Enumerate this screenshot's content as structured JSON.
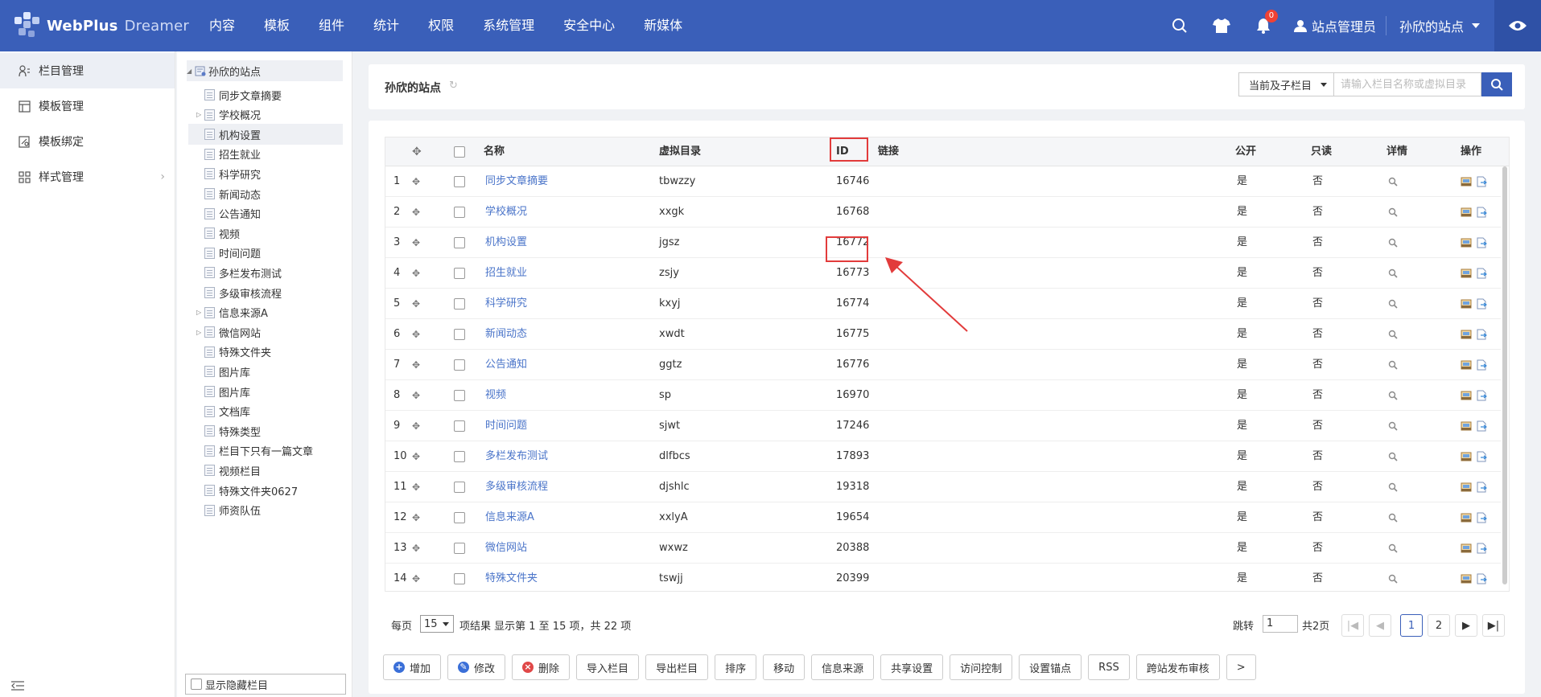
{
  "header": {
    "brand": "WebPlus",
    "brand_sub": "Dreamer",
    "nav": [
      "内容",
      "模板",
      "组件",
      "统计",
      "权限",
      "系统管理",
      "安全中心",
      "新媒体"
    ],
    "notif_count": "0",
    "user": "站点管理员",
    "site": "孙欣的站点"
  },
  "left_menu": {
    "items": [
      {
        "label": "栏目管理",
        "icon": "columns-icon"
      },
      {
        "label": "模板管理",
        "icon": "template-icon"
      },
      {
        "label": "模板绑定",
        "icon": "bind-icon"
      },
      {
        "label": "样式管理",
        "icon": "style-icon"
      }
    ]
  },
  "tree": {
    "root": "孙欣的站点",
    "nodes": [
      {
        "label": "同步文章摘要",
        "expandable": false
      },
      {
        "label": "学校概况",
        "expandable": true
      },
      {
        "label": "机构设置",
        "expandable": false,
        "selected": true
      },
      {
        "label": "招生就业",
        "expandable": false
      },
      {
        "label": "科学研究",
        "expandable": false
      },
      {
        "label": "新闻动态",
        "expandable": false
      },
      {
        "label": "公告通知",
        "expandable": false
      },
      {
        "label": "视频",
        "expandable": false
      },
      {
        "label": "时间问题",
        "expandable": false
      },
      {
        "label": "多栏发布测试",
        "expandable": false
      },
      {
        "label": "多级审核流程",
        "expandable": false
      },
      {
        "label": "信息来源A",
        "expandable": true
      },
      {
        "label": "微信网站",
        "expandable": true
      },
      {
        "label": "特殊文件夹",
        "expandable": false
      },
      {
        "label": "图片库",
        "expandable": false
      },
      {
        "label": "图片库",
        "expandable": false
      },
      {
        "label": "文档库",
        "expandable": false
      },
      {
        "label": "特殊类型",
        "expandable": false
      },
      {
        "label": "栏目下只有一篇文章",
        "expandable": false
      },
      {
        "label": "视频栏目",
        "expandable": false
      },
      {
        "label": "特殊文件夹0627",
        "expandable": false
      },
      {
        "label": "师资队伍",
        "expandable": false
      }
    ],
    "show_hidden_label": "显示隐藏栏目"
  },
  "content": {
    "site_title": "孙欣的站点",
    "scope_select": "当前及子栏目",
    "search_placeholder": "请输入栏目名称或虚拟目录"
  },
  "table": {
    "headers": {
      "name": "名称",
      "vdir": "虚拟目录",
      "id": "ID",
      "link": "链接",
      "public": "公开",
      "readonly": "只读",
      "detail": "详情",
      "ops": "操作"
    },
    "rows": [
      {
        "no": "1",
        "name": "同步文章摘要",
        "vdir": "tbwzzy",
        "id": "16746",
        "public": "是",
        "readonly": "否"
      },
      {
        "no": "2",
        "name": "学校概况",
        "vdir": "xxgk",
        "id": "16768",
        "public": "是",
        "readonly": "否"
      },
      {
        "no": "3",
        "name": "机构设置",
        "vdir": "jgsz",
        "id": "16772",
        "public": "是",
        "readonly": "否"
      },
      {
        "no": "4",
        "name": "招生就业",
        "vdir": "zsjy",
        "id": "16773",
        "public": "是",
        "readonly": "否"
      },
      {
        "no": "5",
        "name": "科学研究",
        "vdir": "kxyj",
        "id": "16774",
        "public": "是",
        "readonly": "否"
      },
      {
        "no": "6",
        "name": "新闻动态",
        "vdir": "xwdt",
        "id": "16775",
        "public": "是",
        "readonly": "否"
      },
      {
        "no": "7",
        "name": "公告通知",
        "vdir": "ggtz",
        "id": "16776",
        "public": "是",
        "readonly": "否"
      },
      {
        "no": "8",
        "name": "视频",
        "vdir": "sp",
        "id": "16970",
        "public": "是",
        "readonly": "否"
      },
      {
        "no": "9",
        "name": "时间问题",
        "vdir": "sjwt",
        "id": "17246",
        "public": "是",
        "readonly": "否"
      },
      {
        "no": "10",
        "name": "多栏发布测试",
        "vdir": "dlfbcs",
        "id": "17893",
        "public": "是",
        "readonly": "否"
      },
      {
        "no": "11",
        "name": "多级审核流程",
        "vdir": "djshlc",
        "id": "19318",
        "public": "是",
        "readonly": "否"
      },
      {
        "no": "12",
        "name": "信息来源A",
        "vdir": "xxlyA",
        "id": "19654",
        "public": "是",
        "readonly": "否"
      },
      {
        "no": "13",
        "name": "微信网站",
        "vdir": "wxwz",
        "id": "20388",
        "public": "是",
        "readonly": "否"
      },
      {
        "no": "14",
        "name": "特殊文件夹",
        "vdir": "tswjj",
        "id": "20399",
        "public": "是",
        "readonly": "否"
      }
    ]
  },
  "pager": {
    "per_page_label": "每页",
    "per_page": "15",
    "summary": "项结果 显示第 1 至 15 项，共 22 项",
    "jump_label": "跳转",
    "jump_value": "1",
    "total_pages": "共2页",
    "pages": [
      "1",
      "2"
    ],
    "current_page": "1"
  },
  "toolbar": {
    "add": "增加",
    "edit": "修改",
    "delete": "删除",
    "buttons": [
      "导入栏目",
      "导出栏目",
      "排序",
      "移动",
      "信息来源",
      "共享设置",
      "访问控制",
      "设置锚点",
      "RSS",
      "跨站发布审核"
    ],
    "more": ">"
  },
  "colors": {
    "header_bg": "#3a5fb9",
    "link": "#4a74c9",
    "highlight": "#e23b3b"
  }
}
